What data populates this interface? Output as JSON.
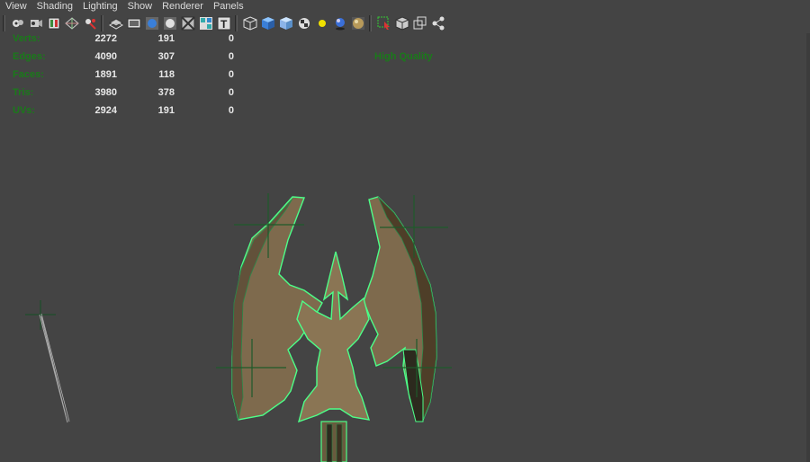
{
  "menu": [
    "View",
    "Shading",
    "Lighting",
    "Show",
    "Renderer",
    "Panels"
  ],
  "toolbar": {
    "icons": [
      "camera-attributes-icon",
      "bookmark-icon",
      "image-plane-icon",
      "grid-icon",
      "film-gate-icon",
      "wireframe-shaded-icon",
      "resolution-gate-icon",
      "smooth-shade-icon",
      "flat-shade-icon",
      "xray-icon",
      "texture-icon",
      "text-icon",
      "wireframe-cube-icon",
      "shaded-cube-icon",
      "textured-cube-icon",
      "checker-icon",
      "light-icon",
      "shadow-sphere-icon",
      "ambient-occlusion-icon",
      "select-highlight-icon",
      "isolate-select-icon",
      "isolate-view-icon",
      "share-icon"
    ]
  },
  "hud": {
    "rows": [
      {
        "label": "Verts:",
        "v1": "2272",
        "v2": "191",
        "v3": "0"
      },
      {
        "label": "Edges:",
        "v1": "4090",
        "v2": "307",
        "v3": "0"
      },
      {
        "label": "Faces:",
        "v1": "1891",
        "v2": "118",
        "v3": "0"
      },
      {
        "label": "Tris:",
        "v1": "3980",
        "v2": "378",
        "v3": "0"
      },
      {
        "label": "UVs:",
        "v1": "2924",
        "v2": "191",
        "v3": "0"
      }
    ],
    "quality": "High Quality"
  },
  "colors": {
    "background": "#444444",
    "hud_label": "#1a7a1a",
    "hud_value": "#e8e8e8",
    "model_fill": "#7e6a4d",
    "selection": "#4dff88",
    "menu_text": "#dcdcdc"
  }
}
